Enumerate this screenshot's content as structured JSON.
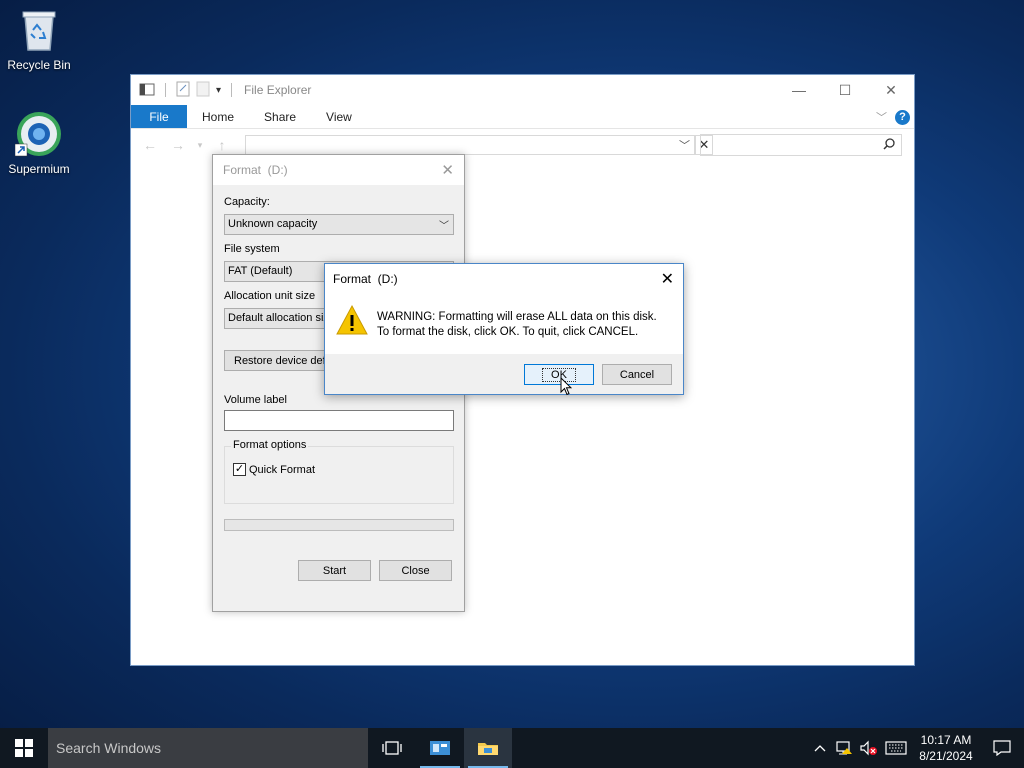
{
  "desktop": {
    "icons": [
      {
        "label": "Recycle Bin",
        "icon": "recycle-bin-icon"
      },
      {
        "label": "Supermium",
        "icon": "supermium-icon"
      }
    ]
  },
  "explorer": {
    "title": "File Explorer",
    "tabs": [
      "File",
      "Home",
      "Share",
      "View"
    ]
  },
  "format_dialog": {
    "title": "Format  (D:)",
    "capacity_label": "Capacity:",
    "capacity_value": "Unknown capacity",
    "filesystem_label": "File system",
    "filesystem_value": "FAT (Default)",
    "alloc_label": "Allocation unit size",
    "alloc_value": "Default allocation siz",
    "restore_button": "Restore device def",
    "volume_label": "Volume label",
    "volume_value": "",
    "options_title": "Format options",
    "quick_format_label": "Quick Format",
    "quick_format_checked": true,
    "start_button": "Start",
    "close_button": "Close"
  },
  "warning_dialog": {
    "title": "Format  (D:)",
    "message_line1": "WARNING: Formatting will erase ALL data on this disk.",
    "message_line2": "To format the disk, click OK. To quit, click CANCEL.",
    "ok_button": "OK",
    "cancel_button": "Cancel"
  },
  "taskbar": {
    "search_placeholder": "Search Windows",
    "time": "10:17 AM",
    "date": "8/21/2024"
  },
  "colors": {
    "accent": "#1979ca",
    "taskbar": "#101821",
    "warning_yellow": "#f5c400"
  }
}
